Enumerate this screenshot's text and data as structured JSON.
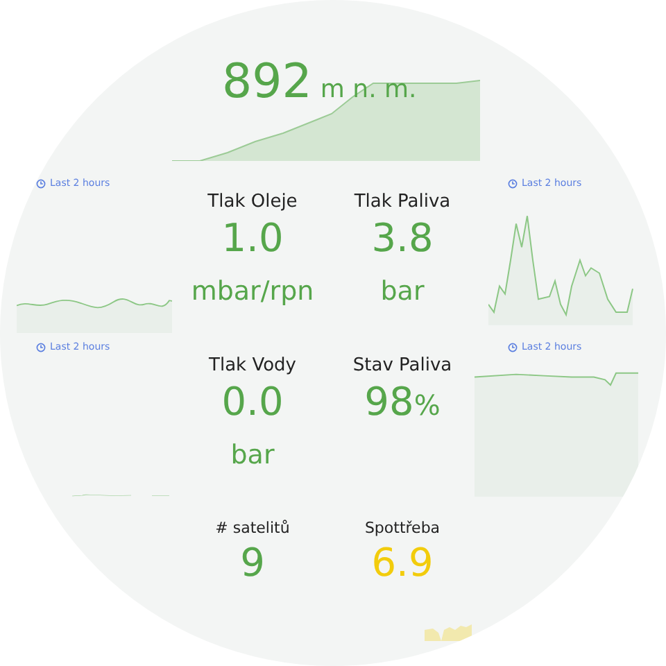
{
  "altitude": {
    "value": "892",
    "unit": "m n. m."
  },
  "panels": [
    {
      "kind": "graph",
      "time_label": "Last 2 hours"
    },
    {
      "kind": "stat",
      "title": "Tlak Oleje",
      "value": "1.0",
      "unit": "mbar/rpn",
      "color": "#56a64b"
    },
    {
      "kind": "stat",
      "title": "Tlak Paliva",
      "value": "3.8",
      "unit": "bar",
      "color": "#56a64b"
    },
    {
      "kind": "graph",
      "time_label": "Last 2 hours"
    },
    {
      "kind": "graph",
      "time_label": "Last 2 hours"
    },
    {
      "kind": "stat",
      "title": "Tlak Vody",
      "value": "0.0",
      "unit": "bar",
      "color": "#56a64b"
    },
    {
      "kind": "stat",
      "title": "Stav Paliva",
      "value": "98",
      "suffix": "%",
      "color": "#56a64b"
    },
    {
      "kind": "graph",
      "time_label": "Last 2 hours"
    },
    {
      "kind": "spacer"
    },
    {
      "kind": "stat",
      "title": "# satelitů",
      "value": "9",
      "color": "#56a64b"
    },
    {
      "kind": "stat-trend",
      "title": "Spottřeba",
      "value": "6.9",
      "color": "#f2cc0c"
    },
    {
      "kind": "spacer"
    }
  ]
}
